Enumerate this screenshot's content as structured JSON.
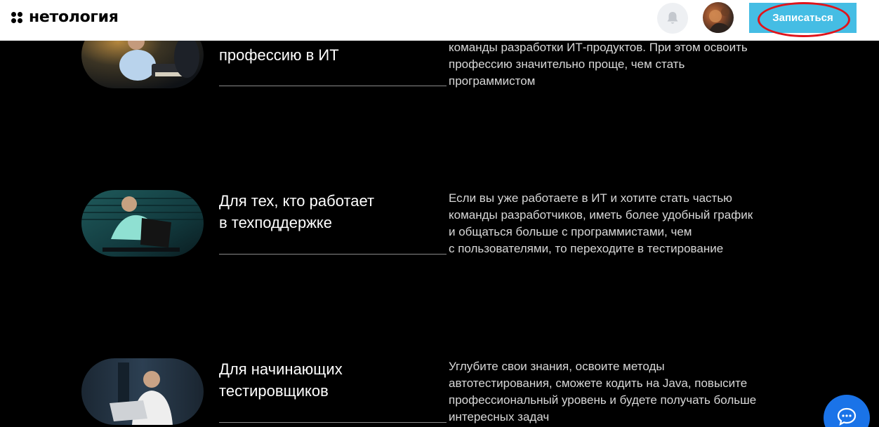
{
  "header": {
    "logo_text": "нетология",
    "signup_label": "Записаться",
    "bell_icon": "bell-icon",
    "avatar_icon": "user-avatar"
  },
  "rows": [
    {
      "title": "профессию в ИТ",
      "description": "команды разработки ИТ-продуктов. При этом освоить\nпрофессию значительно проще, чем стать\nпрограммистом"
    },
    {
      "title": "Для тех, кто работает\nв техподдержке",
      "description": "Если вы уже работаете в ИТ и хотите стать частью\nкоманды разработчиков, иметь более удобный график\nи общаться больше с программистами, чем\nс пользователями, то переходите в тестирование"
    },
    {
      "title": "Для начинающих\nтестировщиков",
      "description": "Углубите свои знания, освоите методы\nавтотестирования, сможете кодить на Java, повысите\nпрофессиональный уровень и будете получать больше\nинтересных задач"
    }
  ],
  "colors": {
    "accent": "#45bde4",
    "highlight": "#e0141b",
    "chat": "#1a73e8",
    "background": "#000000"
  },
  "chat": {
    "icon": "chat-bubble-icon"
  }
}
